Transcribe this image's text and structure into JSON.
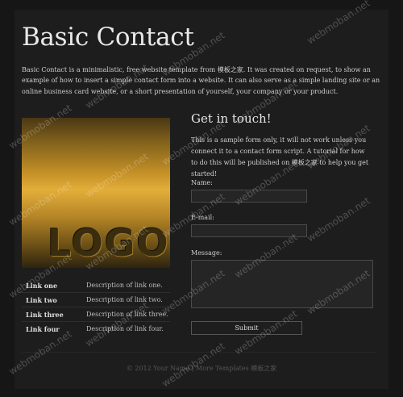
{
  "header": {
    "title": "Basic Contact"
  },
  "intro": "Basic Contact is a minimalistic, free website template from 模板之家. It was created on request, to show an example of how to insert a simple contact form into a website. It can also serve as a simple landing site or an online business card website, or a short presentation of yourself, your company or your product.",
  "logo": {
    "text": "LOGO"
  },
  "links": [
    {
      "name": "Link one",
      "desc": "Description of link one."
    },
    {
      "name": "Link two",
      "desc": "Description of link two."
    },
    {
      "name": "Link three",
      "desc": "Description of link three."
    },
    {
      "name": "Link four",
      "desc": "Description of link four."
    }
  ],
  "contact": {
    "heading": "Get in touch!",
    "text": "This is a sample form only, it will not work unless you connect it to a contact form script. A tutorial for how to do this will be published on 模板之家 to help you get started!",
    "name_label": "Name:",
    "email_label": "E-mail:",
    "message_label": "Message:",
    "submit_label": "Submit"
  },
  "footer": "© 2012 Your Name | More Templates 模板之家",
  "watermark": "webmoban.net"
}
